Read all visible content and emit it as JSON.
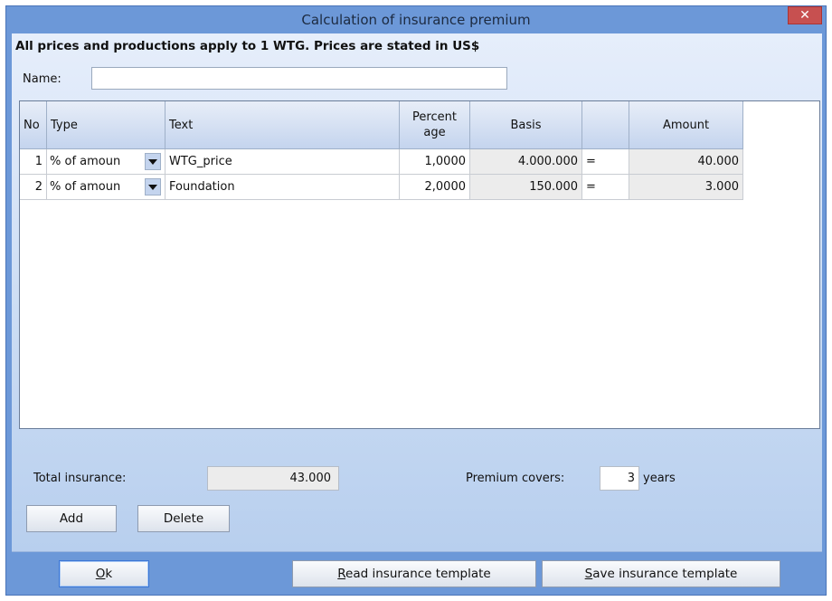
{
  "window": {
    "title": "Calculation of insurance premium",
    "close_symbol": "✕"
  },
  "header": {
    "info": "All prices and productions apply to 1 WTG. Prices are stated in US$",
    "name_label": "Name:",
    "name_value": ""
  },
  "table": {
    "columns": {
      "no": "No",
      "type": "Type",
      "text": "Text",
      "percent": "Percent age",
      "basis": "Basis",
      "eq": "",
      "amount": "Amount"
    },
    "rows": [
      {
        "no": "1",
        "type": "% of amoun",
        "text": "WTG_price",
        "percent": "1,0000",
        "basis": "4.000.000",
        "eq": "=",
        "amount": "40.000"
      },
      {
        "no": "2",
        "type": "% of amoun",
        "text": "Foundation",
        "percent": "2,0000",
        "basis": "150.000",
        "eq": "=",
        "amount": "3.000"
      }
    ]
  },
  "totals": {
    "label": "Total insurance:",
    "value": "43.000",
    "premium_covers_label": "Premium covers:",
    "premium_covers_value": "3",
    "years_label": "years"
  },
  "buttons": {
    "add": "Add",
    "delete": "Delete",
    "ok_prefix": "O",
    "ok_underline_char": "k",
    "read_template_first": "R",
    "read_template_rest": "ead insurance template",
    "save_template_first": "S",
    "save_template_rest": "ave insurance template"
  },
  "icons": {
    "close": "close-icon",
    "dropdown": "chevron-down-icon"
  },
  "colors": {
    "titlebar": "#6c98d8",
    "close_button": "#c75050"
  }
}
